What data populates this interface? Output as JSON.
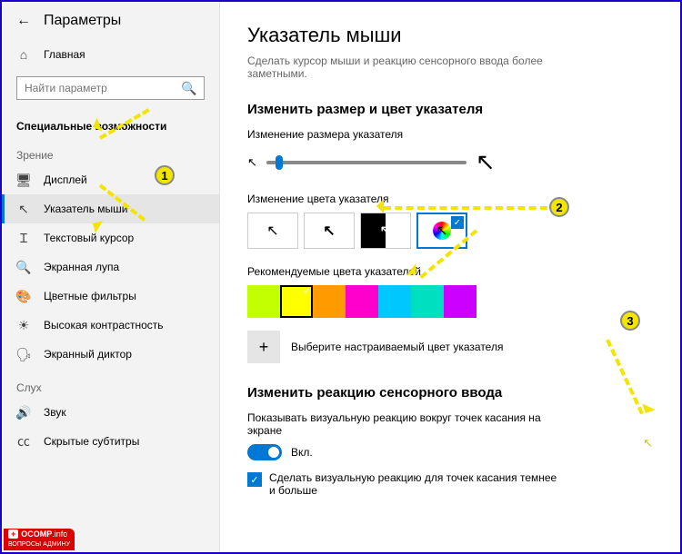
{
  "header": {
    "title": "Параметры"
  },
  "search": {
    "placeholder": "Найти параметр"
  },
  "sidebar": {
    "home": "Главная",
    "category": "Специальные возможности",
    "groups": [
      {
        "label": "Зрение",
        "items": [
          {
            "icon": "display",
            "label": "Дисплей"
          },
          {
            "icon": "pointer",
            "label": "Указатель мыши",
            "active": true
          },
          {
            "icon": "text-cursor",
            "label": "Текстовый курсор"
          },
          {
            "icon": "magnifier",
            "label": "Экранная лупа"
          },
          {
            "icon": "filters",
            "label": "Цветные фильтры"
          },
          {
            "icon": "contrast",
            "label": "Высокая контрастность"
          },
          {
            "icon": "narrator",
            "label": "Экранный диктор"
          }
        ]
      },
      {
        "label": "Слух",
        "items": [
          {
            "icon": "sound",
            "label": "Звук"
          },
          {
            "icon": "cc",
            "label": "Скрытые субтитры"
          }
        ]
      }
    ]
  },
  "main": {
    "title": "Указатель мыши",
    "desc": "Сделать курсор мыши и реакцию сенсорного ввода более заметными.",
    "section1": "Изменить размер и цвет указателя",
    "size_label": "Изменение размера указателя",
    "color_label": "Изменение цвета указателя",
    "rec_label": "Рекомендуемые цвета указателей",
    "rec_colors": [
      "#c4ff00",
      "#ffff00",
      "#ff9a00",
      "#ff00cc",
      "#00c8ff",
      "#00e0c0",
      "#cc00ff"
    ],
    "selected_color_index": 1,
    "custom_label": "Выберите настраиваемый цвет указателя",
    "section2": "Изменить реакцию сенсорного ввода",
    "touch_label": "Показывать визуальную реакцию вокруг точек касания на экране",
    "toggle_text": "Вкл.",
    "darker_label": "Сделать визуальную реакцию для точек касания темнее и больше"
  },
  "annotations": {
    "markers": [
      "1",
      "2",
      "3"
    ]
  },
  "watermark": {
    "brand": "OCOMP",
    "tld": ".info",
    "sub": "ВОПРОСЫ АДМИНУ"
  }
}
